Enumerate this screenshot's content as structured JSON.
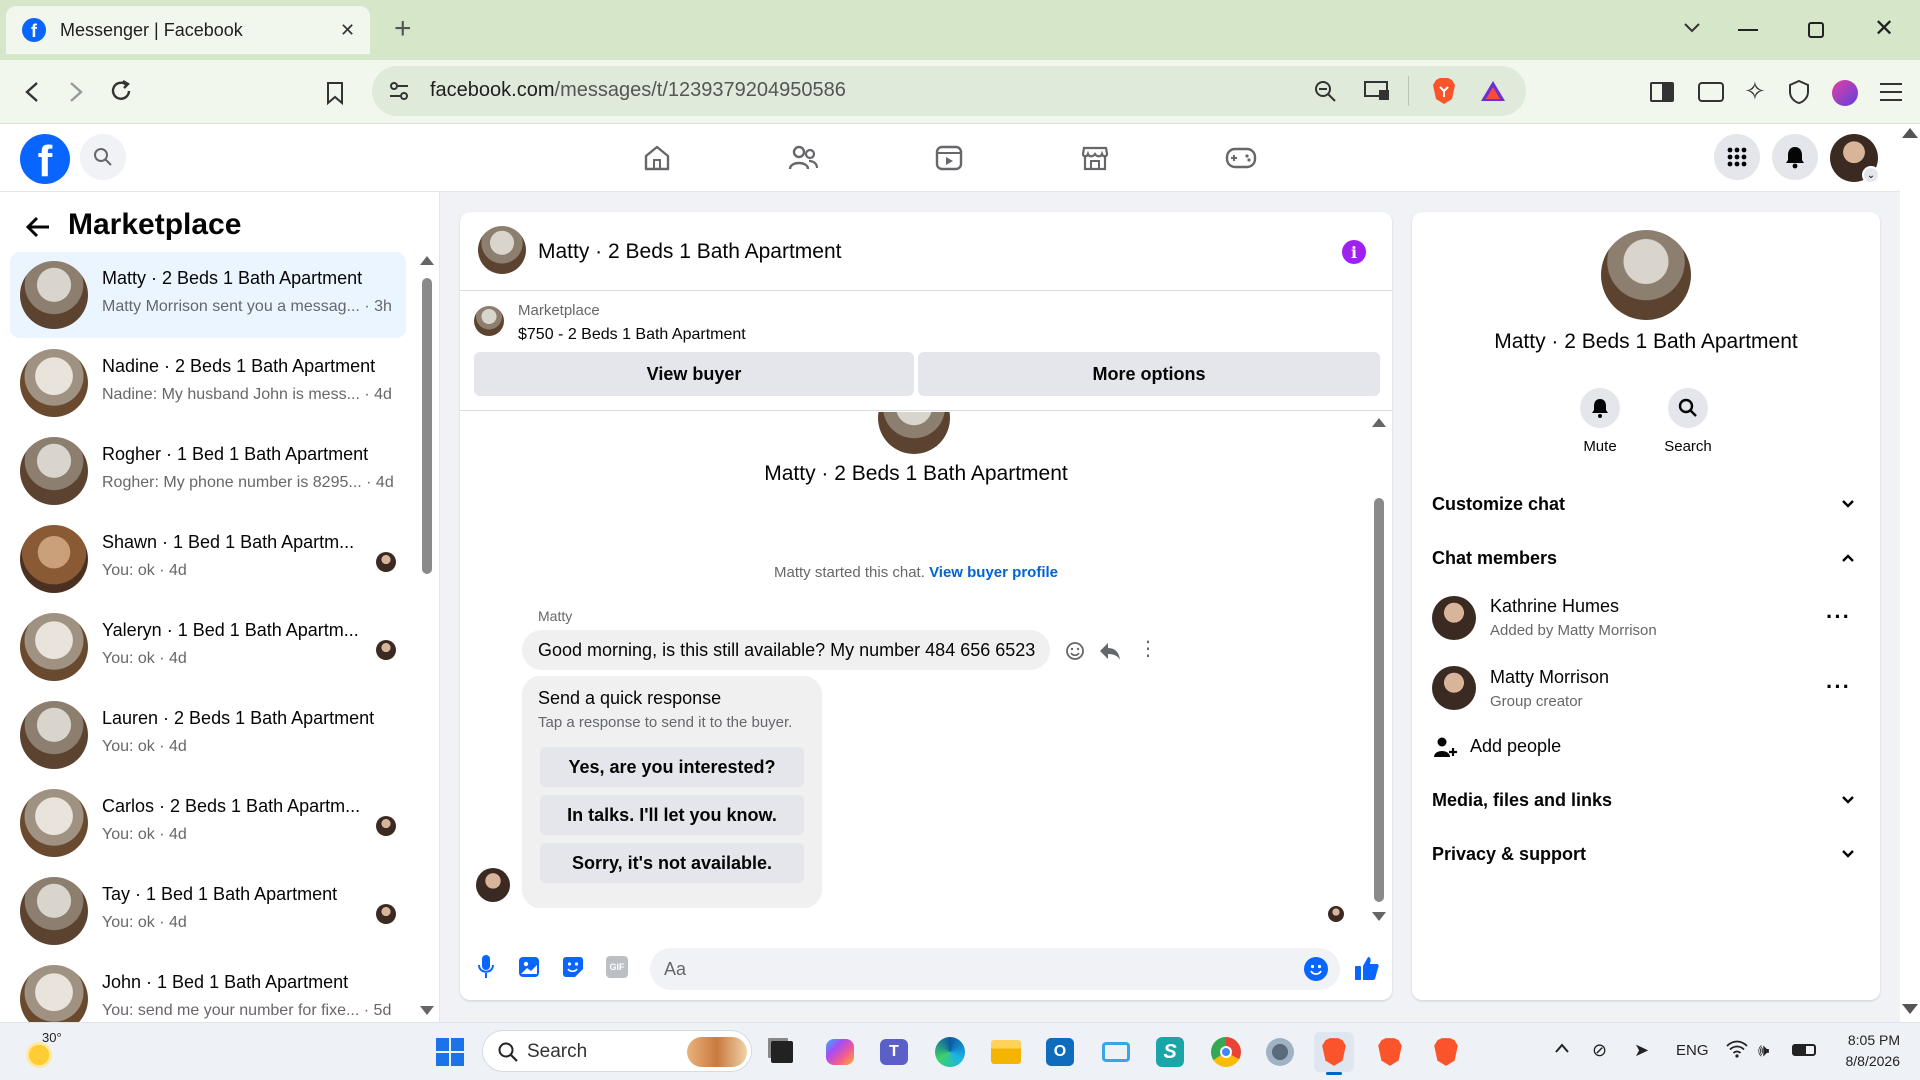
{
  "browser": {
    "tab_title": "Messenger | Facebook",
    "new_tab": "+",
    "url_domain": "facebook.com",
    "url_path": "/messages/t/1239379204950586"
  },
  "facebook": {
    "brand_color": "#0866ff"
  },
  "left": {
    "title": "Marketplace",
    "conversations": [
      {
        "name": "Matty · 2 Beds 1 Bath Apartment",
        "preview": "Matty Morrison sent you a messag... · 3h"
      },
      {
        "name": "Nadine · 2 Beds 1 Bath Apartment",
        "preview": "Nadine: My husband John is mess... · 4d"
      },
      {
        "name": "Rogher · 1 Bed 1 Bath Apartment",
        "preview": "Rogher: My phone number is 8295... · 4d"
      },
      {
        "name": "Shawn · 1 Bed 1 Bath Apartm...",
        "preview": "You: ok · 4d"
      },
      {
        "name": "Yaleryn · 1 Bed 1 Bath Apartm...",
        "preview": "You: ok · 4d"
      },
      {
        "name": "Lauren · 2 Beds 1 Bath Apartment",
        "preview": "You: ok · 4d"
      },
      {
        "name": "Carlos · 2 Beds 1 Bath Apartm...",
        "preview": "You: ok · 4d"
      },
      {
        "name": "Tay · 1 Bed 1 Bath Apartment",
        "preview": "You: ok · 4d"
      },
      {
        "name": "John · 1 Bed 1 Bath Apartment",
        "preview": "You: send me your number for fixe... · 5d"
      }
    ]
  },
  "chat": {
    "title": "Matty · 2 Beds 1 Bath Apartment",
    "listing_source": "Marketplace",
    "listing_title": "$750 - 2 Beds 1 Bath Apartment",
    "view_buyer": "View buyer",
    "more_options": "More options",
    "center_name": "Matty · 2 Beds 1 Bath Apartment",
    "started_text": "Matty started this chat.",
    "view_buyer_profile": "View buyer profile",
    "sender": "Matty",
    "message": "Good morning, is this still available? My number 484 656 6523",
    "quick_title": "Send a quick response",
    "quick_sub": "Tap a response to send it to the buyer.",
    "quick_responses": [
      "Yes, are you interested?",
      "In talks. I'll let you know.",
      "Sorry, it's not available."
    ],
    "composer_placeholder": "Aa",
    "gif_label": "GIF"
  },
  "right": {
    "name": "Matty · 2 Beds 1 Bath Apartment",
    "mute": "Mute",
    "search": "Search",
    "customize_chat": "Customize chat",
    "chat_members": "Chat members",
    "members": [
      {
        "name": "Kathrine Humes",
        "sub": "Added by Matty Morrison"
      },
      {
        "name": "Matty Morrison",
        "sub": "Group creator"
      }
    ],
    "add_people": "Add people",
    "media": "Media, files and links",
    "privacy": "Privacy & support"
  },
  "taskbar": {
    "temperature": "30°",
    "search": "Search",
    "lang": "ENG",
    "time": "8:05 PM",
    "date": "8/8/2026"
  }
}
